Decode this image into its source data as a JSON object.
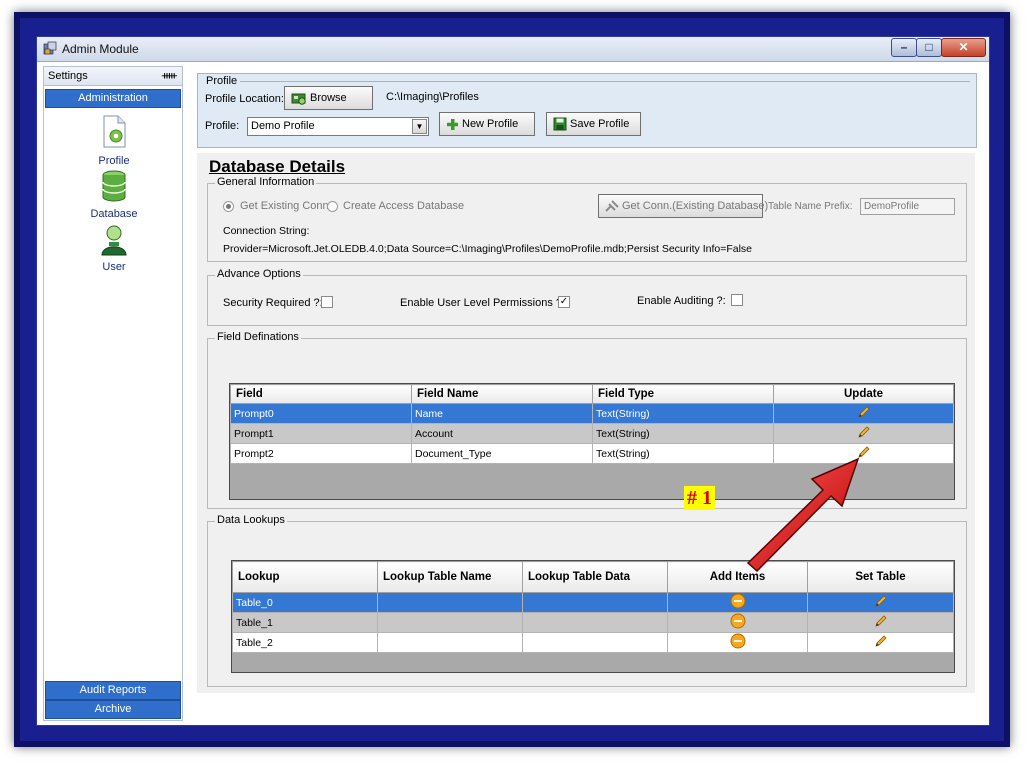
{
  "window": {
    "title": "Admin Module"
  },
  "sidebar": {
    "header": "Settings",
    "pin_glyph": "ᚔ",
    "admin_button": "Administration",
    "items": [
      {
        "label": "Profile",
        "icon": "profile-icon"
      },
      {
        "label": "Database",
        "icon": "database-icon"
      },
      {
        "label": "User",
        "icon": "user-icon"
      }
    ],
    "audit_button": "Audit Reports",
    "archive_button": "Archive"
  },
  "profile": {
    "legend": "Profile",
    "location_label": "Profile Location:",
    "browse_label": "Browse",
    "location_value": "C:\\Imaging\\Profiles",
    "profile_label": "Profile:",
    "profile_value": "Demo Profile",
    "new_label": "New Profile",
    "save_label": "Save Profile"
  },
  "database": {
    "title": "Database Details",
    "general": {
      "legend": "General Information",
      "radio_existing": "Get Existing Conn.",
      "radio_access": "Create Access Database",
      "get_conn_label": "Get Conn.(Existing Database)",
      "prefix_label": "Table Name Prefix:",
      "prefix_value": "DemoProfile",
      "conn_label": "Connection String:",
      "conn_value": "Provider=Microsoft.Jet.OLEDB.4.0;Data Source=C:\\Imaging\\Profiles\\DemoProfile.mdb;Persist Security Info=False"
    },
    "advance": {
      "legend": "Advance Options",
      "security_label": "Security Required ?:",
      "security_checked": false,
      "user_perm_label": "Enable User Level Permissions ?:",
      "user_perm_checked": true,
      "auditing_label": "Enable Auditing ?:",
      "auditing_checked": false,
      "check_glyph": "✓"
    },
    "fields": {
      "legend": "Field Definations",
      "columns": [
        "Field",
        "Field Name",
        "Field Type",
        "Update"
      ],
      "rows": [
        {
          "field": "Prompt0",
          "name": "Name",
          "type": "Text(String)"
        },
        {
          "field": "Prompt1",
          "name": "Account",
          "type": "Text(String)"
        },
        {
          "field": "Prompt2",
          "name": "Document_Type",
          "type": "Text(String)"
        }
      ]
    },
    "lookups": {
      "legend": "Data Lookups",
      "columns": [
        "Lookup",
        "Lookup Table Name",
        "Lookup Table Data",
        "Add Items",
        "Set Table"
      ],
      "rows": [
        {
          "lookup": "Table_0",
          "table_name": "",
          "table_data": ""
        },
        {
          "lookup": "Table_1",
          "table_name": "",
          "table_data": ""
        },
        {
          "lookup": "Table_2",
          "table_name": "",
          "table_data": ""
        }
      ]
    }
  },
  "annotation": {
    "text": "# 1",
    "color": "#e00000",
    "background": "#ffff00"
  },
  "icons": {
    "update": "pencil-icon",
    "add_items": "minus-circle-icon",
    "set_table": "pencil-icon"
  },
  "colors": {
    "selection": "#3578d3",
    "sidebar_button": "#2f6fcb",
    "frame": "#1a1f8f"
  }
}
